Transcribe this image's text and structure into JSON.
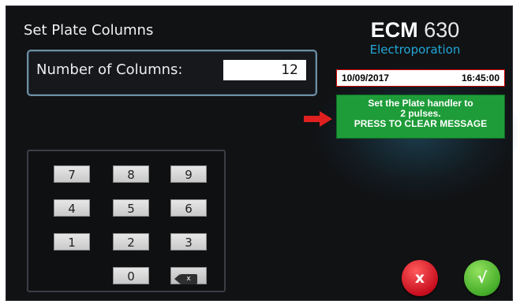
{
  "page": {
    "title": "Set Plate Columns"
  },
  "columns": {
    "label": "Number of Columns:",
    "value": "12"
  },
  "brand": {
    "name": "ECM",
    "model": "630",
    "subtitle": "Electroporation"
  },
  "status": {
    "date": "10/09/2017",
    "time": "16:45:00",
    "message_lines": [
      "Set the Plate handler to",
      "2 pulses.",
      "PRESS TO CLEAR MESSAGE"
    ]
  },
  "keypad": {
    "keys": [
      "7",
      "8",
      "9",
      "4",
      "5",
      "6",
      "1",
      "2",
      "3",
      "0"
    ],
    "backspace_icon": "backspace-icon",
    "backspace_glyph": "x"
  },
  "actions": {
    "cancel_label": "x",
    "confirm_label": "√"
  },
  "colors": {
    "background": "#111214",
    "accent_blue": "#22a7d8",
    "message_green": "#1e9c39",
    "cancel_red": "#c80f1f",
    "confirm_green": "#45ad2a",
    "arrow_red": "#e02020"
  }
}
